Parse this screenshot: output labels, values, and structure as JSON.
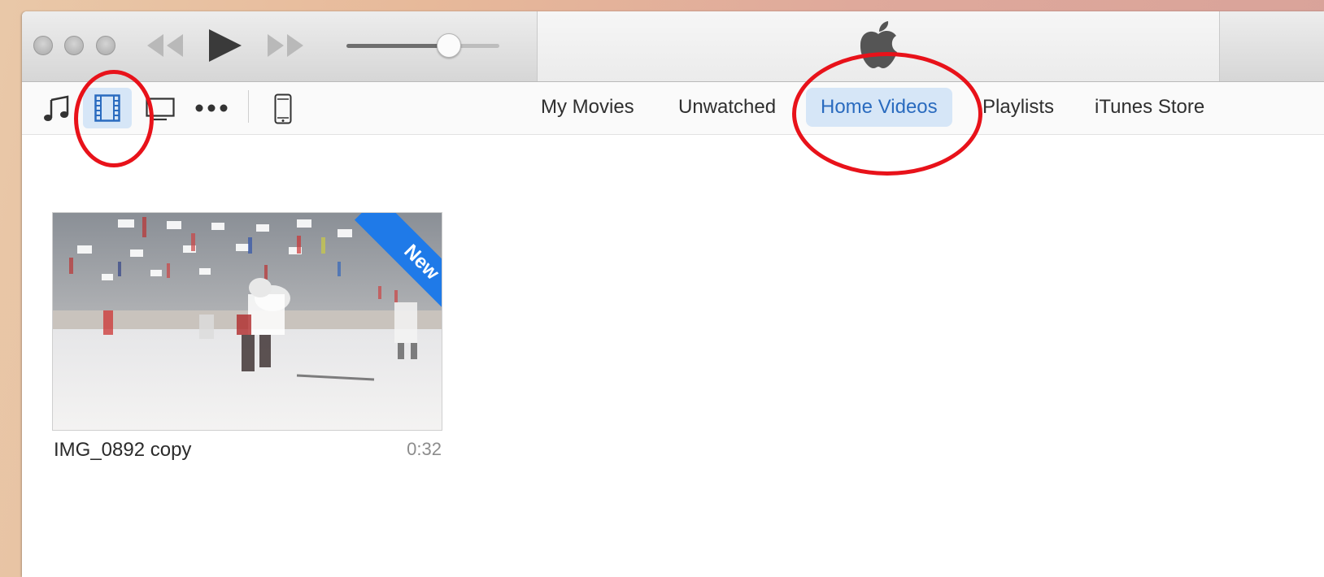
{
  "toolbar": {
    "media_buttons": [
      {
        "name": "music-icon"
      },
      {
        "name": "movies-icon",
        "selected": true
      },
      {
        "name": "tv-shows-icon"
      },
      {
        "name": "more-icon"
      },
      {
        "name": "iphone-icon"
      }
    ],
    "tabs": [
      {
        "label": "My Movies"
      },
      {
        "label": "Unwatched"
      },
      {
        "label": "Home Videos",
        "active": true
      },
      {
        "label": "Playlists"
      },
      {
        "label": "iTunes Store"
      }
    ]
  },
  "player": {
    "volume_level": 0.67,
    "lcd_icon": "apple-logo-icon"
  },
  "library": {
    "items": [
      {
        "title": "IMG_0892 copy",
        "duration": "0:32",
        "badge": "New"
      }
    ]
  },
  "colors": {
    "accent": "#2a6bbf",
    "selection_bg": "#d6e6f7",
    "badge": "#1f7ae8",
    "annotation_circle": "#e8121a"
  }
}
